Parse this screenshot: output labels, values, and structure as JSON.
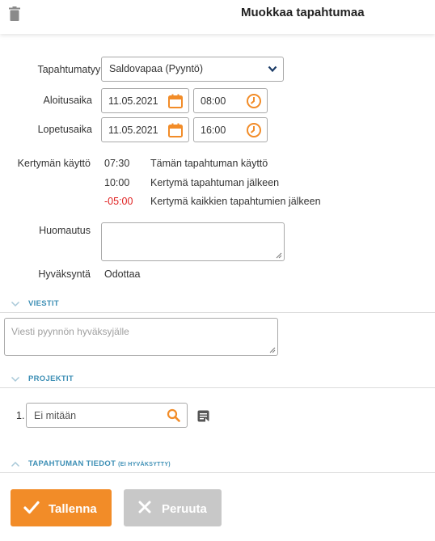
{
  "header": {
    "title": "Muokkaa tapahtumaa",
    "delete_icon": "trash-icon"
  },
  "form": {
    "event_type": {
      "label": "Tapahtumatyyppi",
      "value": "Saldovapaa (Pyyntö)"
    },
    "start": {
      "label": "Aloitusaika",
      "date": "11.05.2021",
      "time": "08:00"
    },
    "end": {
      "label": "Lopetusaika",
      "date": "11.05.2021",
      "time": "16:00"
    },
    "accrual": {
      "label": "Kertymän käyttö",
      "rows": [
        {
          "value": "07:30",
          "text": "Tämän tapahtuman käyttö"
        },
        {
          "value": "10:00",
          "text": "Kertymä tapahtuman jälkeen"
        },
        {
          "value": "-05:00",
          "text": "Kertymä kaikkien tapahtumien jälkeen"
        }
      ]
    },
    "note": {
      "label": "Huomautus",
      "value": ""
    },
    "approval": {
      "label": "Hyväksyntä",
      "value": "Odottaa"
    }
  },
  "messages": {
    "title": "VIESTIT",
    "placeholder": "Viesti pyynnön hyväksyjälle"
  },
  "projects": {
    "title": "PROJEKTIT",
    "items": [
      {
        "index": "1.",
        "value": "Ei mitään"
      }
    ]
  },
  "details": {
    "title": "TAPAHTUMAN TIEDOT",
    "subtitle": "(EI HYVÄKSYTTY)"
  },
  "actions": {
    "save_label": "Tallenna",
    "cancel_label": "Peruuta"
  },
  "colors": {
    "accent": "#f28c28",
    "section_title": "#3d8fb5",
    "negative": "#e02020",
    "disabled": "#c8c8c8"
  }
}
